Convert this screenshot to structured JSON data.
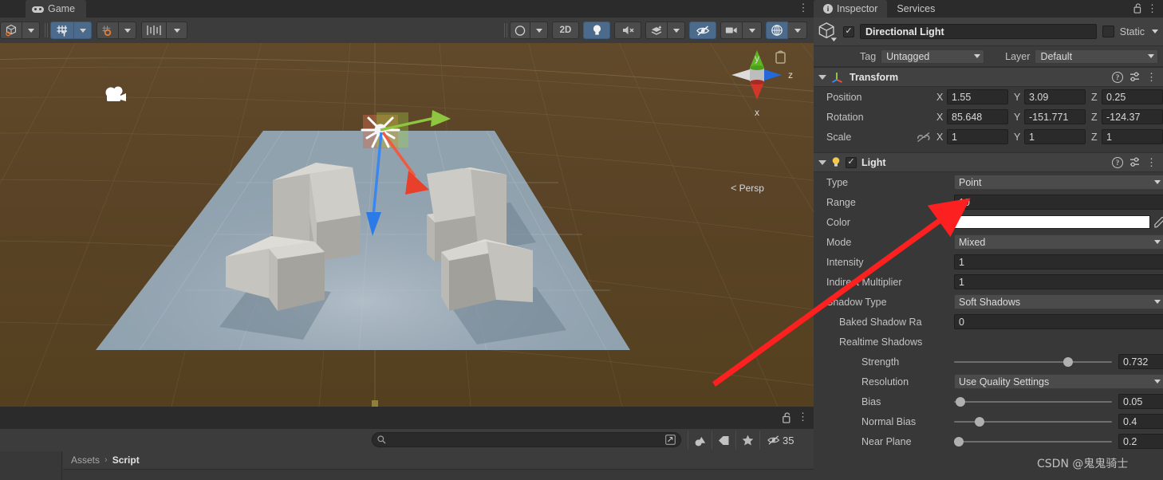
{
  "scene_view": {
    "tab_label": "Game",
    "tab_icon": "gamepad-icon",
    "toolbar_left": [
      {
        "name": "pivot-tool",
        "icon": "cube-pivot-icon",
        "active": false
      },
      {
        "name": "grid-snap",
        "icon": "grid-y-icon",
        "active": true
      },
      {
        "name": "magnet-snap",
        "icon": "magnet-grid-icon",
        "active": false
      },
      {
        "name": "increment-snap",
        "icon": "ruler-icon",
        "active": false
      }
    ],
    "toolbar_right": [
      {
        "name": "shading-mode",
        "icon": "sphere-shaded-icon",
        "active": false
      },
      {
        "name": "2d-toggle",
        "icon": "",
        "label": "2D",
        "active": false
      },
      {
        "name": "scene-lighting",
        "icon": "lightbulb-icon",
        "active": true
      },
      {
        "name": "scene-audio",
        "icon": "speaker-mute-icon",
        "active": false
      },
      {
        "name": "effects-toggle",
        "icon": "effects-icon",
        "active": false
      },
      {
        "name": "hidden-objects",
        "icon": "eye-slash-icon",
        "active": true
      },
      {
        "name": "camera-settings",
        "icon": "camera-icon",
        "active": false
      },
      {
        "name": "gizmos-toggle",
        "icon": "gizmo-globe-icon",
        "active": false
      }
    ],
    "axis_gizmo": {
      "y_label": "y",
      "x_label": "x",
      "z_label": "z",
      "projection_label": "Persp",
      "y_color": "#51bb1f",
      "x_color": "#d03b2d",
      "z_color": "#2668d8"
    },
    "handle_colors": {
      "x": "#e8503a",
      "y": "#8ec63f",
      "z": "#3a87f0"
    },
    "background_color": "#5b4524",
    "platform_color": "#93a3b2"
  },
  "project_panel": {
    "search": {
      "placeholder": "",
      "value": "",
      "icon": "search-icon"
    },
    "filter_buttons": [
      {
        "name": "search-in-scene",
        "icon": "window-expand-icon"
      },
      {
        "name": "filter-by-type",
        "icon": "type-filter-icon"
      },
      {
        "name": "filter-by-label",
        "icon": "label-tag-icon"
      },
      {
        "name": "filter-favorites",
        "icon": "star-icon"
      }
    ],
    "hidden_count": "35",
    "hidden_count_icon": "eye-slash-icon",
    "breadcrumb": {
      "root": "Assets",
      "separator": "›",
      "current": "Script"
    }
  },
  "inspector": {
    "tabs": [
      {
        "label": "Inspector",
        "icon": "info-icon",
        "active": true
      },
      {
        "label": "Services",
        "icon": "",
        "active": false
      }
    ],
    "lock_icon": "lock-open-icon",
    "menu_icon": "kebab-menu-icon",
    "object": {
      "icon": "cube-prefab-icon",
      "enabled": true,
      "name": "Directional Light",
      "static_label": "Static",
      "static_checked": false,
      "tag_label": "Tag",
      "tag_value": "Untagged",
      "layer_label": "Layer",
      "layer_value": "Default"
    },
    "components": [
      {
        "name": "Transform",
        "icon": "transform-axes-icon",
        "expanded": true,
        "has_checkbox": false,
        "header_icons": [
          "help-icon",
          "preset-icon",
          "kebab-menu-icon"
        ],
        "rows": [
          {
            "label": "Position",
            "type": "vector3",
            "x": "1.55",
            "y": "3.09",
            "z": "0.25"
          },
          {
            "label": "Rotation",
            "type": "vector3",
            "x": "85.648",
            "y": "-151.771",
            "z": "-124.37"
          },
          {
            "label": "Scale",
            "type": "vector3",
            "x": "1",
            "y": "1",
            "z": "1",
            "link_icon": "constrain-off-icon"
          }
        ]
      },
      {
        "name": "Light",
        "icon": "lightbulb-icon",
        "expanded": true,
        "has_checkbox": true,
        "enabled": true,
        "header_icons": [
          "help-icon",
          "preset-icon",
          "kebab-menu-icon"
        ],
        "rows": [
          {
            "label": "Type",
            "type": "dropdown",
            "value": "Point",
            "indent": 0
          },
          {
            "label": "Range",
            "type": "text",
            "value": "10",
            "indent": 0
          },
          {
            "label": "Color",
            "type": "color",
            "value": "#ffffff",
            "indent": 0,
            "picker_icon": "eyedropper-icon"
          },
          {
            "label": "Mode",
            "type": "dropdown",
            "value": "Mixed",
            "indent": 0
          },
          {
            "label": "Intensity",
            "type": "text",
            "value": "1",
            "indent": 0
          },
          {
            "label": "Indirect Multiplier",
            "type": "text",
            "value": "1",
            "indent": 0
          },
          {
            "label": "Shadow Type",
            "type": "dropdown",
            "value": "Soft Shadows",
            "indent": 0
          },
          {
            "label": "Baked Shadow Ra",
            "type": "text",
            "value": "0",
            "indent": 1
          },
          {
            "label": "Realtime Shadows",
            "type": "header",
            "value": "",
            "indent": 1
          },
          {
            "label": "Strength",
            "type": "slider",
            "value": "0.732",
            "fill": 0.732,
            "indent": 2
          },
          {
            "label": "Resolution",
            "type": "dropdown",
            "value": "Use Quality Settings",
            "indent": 2
          },
          {
            "label": "Bias",
            "type": "slider",
            "value": "0.05",
            "fill": 0.05,
            "indent": 2
          },
          {
            "label": "Normal Bias",
            "type": "slider",
            "value": "0.4",
            "fill": 0.13,
            "indent": 2
          },
          {
            "label": "Near Plane",
            "type": "slider",
            "value": "0.2",
            "fill": 0.02,
            "indent": 2
          }
        ]
      }
    ]
  },
  "annotation": {
    "arrow_color": "#fc2020",
    "watermark": "CSDN @鬼鬼骑士"
  }
}
